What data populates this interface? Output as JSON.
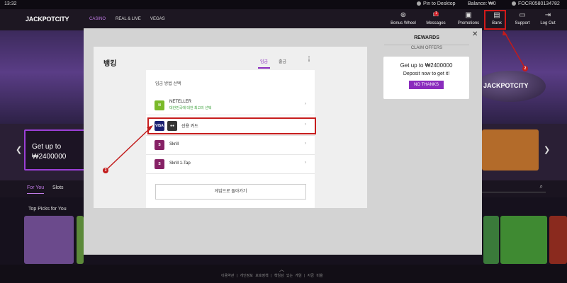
{
  "system_bar": {
    "time": "13:32",
    "pin": "Pin to Desktop",
    "balance": "Balance: ₩0",
    "username": "FOCR0580134782"
  },
  "header": {
    "logo": "JACKPOTCITY",
    "logo_sub": "CASINO",
    "nav": [
      "CASINO",
      "REAL & LIVE",
      "VEGAS"
    ],
    "icons": [
      {
        "label": "Bonus Wheel",
        "icon": "wheel-icon"
      },
      {
        "label": "Messages",
        "icon": "envelope-icon",
        "badge": "1"
      },
      {
        "label": "Promotions",
        "icon": "gift-icon"
      },
      {
        "label": "Bank",
        "icon": "bank-icon"
      },
      {
        "label": "Support",
        "icon": "chat-icon"
      },
      {
        "label": "Log Out",
        "icon": "logout-icon"
      }
    ]
  },
  "background": {
    "blimp_text": "JACKPOTCITY",
    "promo_line1": "Get up to",
    "promo_line2": "₩2400000",
    "tabs": [
      "For You",
      "Slots"
    ],
    "picks_title": "Top Picks for You",
    "footer_links": "이용약관 | 개인정보 보호정책 | 책임감 있는 게임 | 자금 비율"
  },
  "banking": {
    "title": "뱅킹",
    "tabs": [
      "입금",
      "출금"
    ],
    "section_title": "입금 방법 선택",
    "methods": [
      {
        "name": "NETELLER",
        "desc": "대한민국에 대한 최고의 선택"
      },
      {
        "name": "신용 카드",
        "desc": ""
      },
      {
        "name": "Skrill",
        "desc": ""
      },
      {
        "name": "Skrill 1-Tap",
        "desc": ""
      }
    ],
    "back_button": "게임으로 돌아가기"
  },
  "rewards": {
    "title": "REWARDS",
    "claim": "CLAIM OFFERS",
    "offer_line1": "Get up to ₩2400000",
    "offer_line2": "Deposit now to get it!",
    "no_thanks": "NO THANKS"
  },
  "annotations": [
    "2",
    "3"
  ],
  "colors": {
    "accent": "#8a2cbd",
    "highlight": "#c61d1d",
    "modal_bg": "#d3d3d3"
  }
}
